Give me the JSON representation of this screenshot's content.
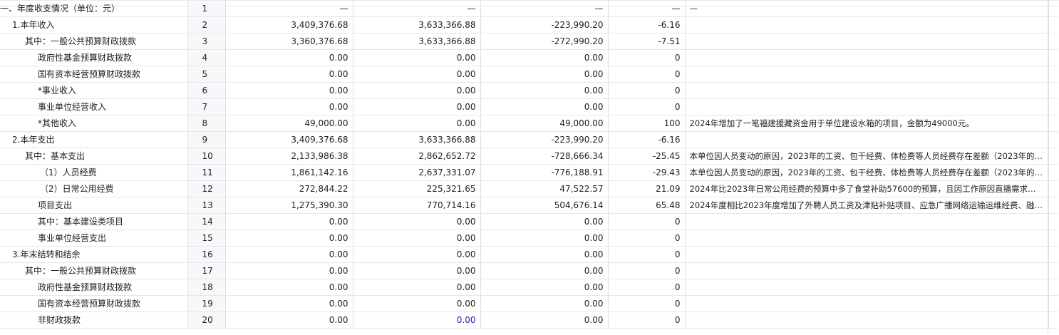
{
  "rows": [
    {
      "name": "一、年度收支情况（单位：元）",
      "no": "1",
      "v2024": "—",
      "v2023": "—",
      "diff": "—",
      "pct": "—",
      "note": "—"
    },
    {
      "name": "1.本年收入",
      "no": "2",
      "v2024": "3,409,376.68",
      "v2023": "3,633,366.88",
      "diff": "-223,990.20",
      "pct": "-6.16",
      "note": ""
    },
    {
      "name": "其中：一般公共预算财政拨款",
      "no": "3",
      "v2024": "3,360,376.68",
      "v2023": "3,633,366.88",
      "diff": "-272,990.20",
      "pct": "-7.51",
      "note": ""
    },
    {
      "name": "政府性基金预算财政拨款",
      "no": "4",
      "v2024": "0.00",
      "v2023": "0.00",
      "diff": "0.00",
      "pct": "0",
      "note": ""
    },
    {
      "name": "国有资本经营预算财政拨款",
      "no": "5",
      "v2024": "0.00",
      "v2023": "0.00",
      "diff": "0.00",
      "pct": "0",
      "note": ""
    },
    {
      "name": "*事业收入",
      "no": "6",
      "v2024": "0.00",
      "v2023": "0.00",
      "diff": "0.00",
      "pct": "0",
      "note": ""
    },
    {
      "name": "事业单位经营收入",
      "no": "7",
      "v2024": "0.00",
      "v2023": "0.00",
      "diff": "0.00",
      "pct": "0",
      "note": ""
    },
    {
      "name": "*其他收入",
      "no": "8",
      "v2024": "49,000.00",
      "v2023": "0.00",
      "diff": "49,000.00",
      "pct": "100",
      "note": "2024年增加了一笔福建援藏资金用于单位建设水箱的项目，金额为49000元。"
    },
    {
      "name": "2.本年支出",
      "no": "9",
      "v2024": "3,409,376.68",
      "v2023": "3,633,366.88",
      "diff": "-223,990.20",
      "pct": "-6.16",
      "note": ""
    },
    {
      "name": "其中：基本支出",
      "no": "10",
      "v2024": "2,133,986.38",
      "v2023": "2,862,652.72",
      "diff": "-728,666.34",
      "pct": "-25.45",
      "note": "本单位因人员变动的原因，2023年的工资、包干经费、体检费等人员经费存在差额（2023年的…"
    },
    {
      "name": "（1）人员经费",
      "no": "11",
      "v2024": "1,861,142.16",
      "v2023": "2,637,331.07",
      "diff": "-776,188.91",
      "pct": "-29.43",
      "note": "本单位因人员变动的原因，2023年的工资、包干经费、体检费等人员经费存在差额（2023年的…"
    },
    {
      "name": "（2）日常公用经费",
      "no": "12",
      "v2024": "272,844.22",
      "v2023": "225,321.65",
      "diff": "47,522.57",
      "pct": "21.09",
      "note": "2024年比2023年日常公用经费的预算中多了食堂补助57600的预算，且因工作原因直播需求…"
    },
    {
      "name": "项目支出",
      "no": "13",
      "v2024": "1,275,390.30",
      "v2023": "770,714.16",
      "diff": "504,676.14",
      "pct": "65.48",
      "note": "2024年度相比2023年度增加了外聘人员工资及津贴补贴项目、应急广播网络运输运维经费、融…"
    },
    {
      "name": "其中：基本建设类项目",
      "no": "14",
      "v2024": "0.00",
      "v2023": "0.00",
      "diff": "0.00",
      "pct": "0",
      "note": ""
    },
    {
      "name": "事业单位经营支出",
      "no": "15",
      "v2024": "0.00",
      "v2023": "0.00",
      "diff": "0.00",
      "pct": "0",
      "note": ""
    },
    {
      "name": "3.年末结转和结余",
      "no": "16",
      "v2024": "0.00",
      "v2023": "0.00",
      "diff": "0.00",
      "pct": "0",
      "note": ""
    },
    {
      "name": "其中：一般公共预算财政拨款",
      "no": "17",
      "v2024": "0.00",
      "v2023": "0.00",
      "diff": "0.00",
      "pct": "0",
      "note": ""
    },
    {
      "name": "政府性基金预算财政拨款",
      "no": "18",
      "v2024": "0.00",
      "v2023": "0.00",
      "diff": "0.00",
      "pct": "0",
      "note": ""
    },
    {
      "name": "国有资本经营预算财政拨款",
      "no": "19",
      "v2024": "0.00",
      "v2023": "0.00",
      "diff": "0.00",
      "pct": "0",
      "note": ""
    },
    {
      "name": "非财政拨款",
      "no": "20",
      "v2024": "0.00",
      "v2023": "0.00",
      "diff": "0.00",
      "pct": "0",
      "note": ""
    }
  ]
}
